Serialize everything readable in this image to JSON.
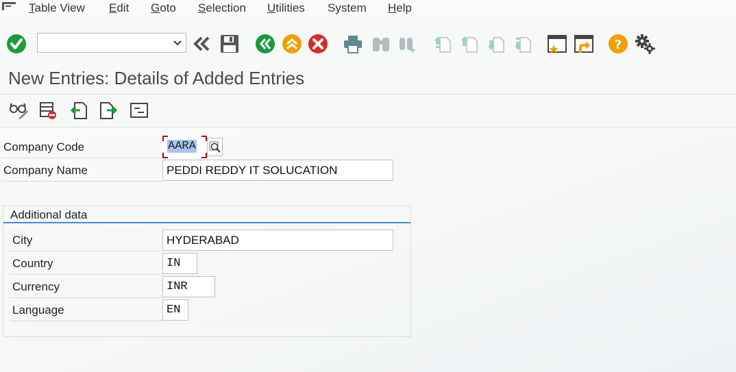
{
  "menubar": {
    "items": [
      {
        "underline": "T",
        "rest": "able View"
      },
      {
        "underline": "E",
        "rest": "dit"
      },
      {
        "underline": "G",
        "rest": "oto"
      },
      {
        "underline": "S",
        "rest": "election"
      },
      {
        "underline": "U",
        "rest": "tilities"
      },
      {
        "underline": "",
        "rest": "System"
      },
      {
        "underline": "H",
        "rest": "elp"
      }
    ]
  },
  "toolbar": {
    "command_value": "",
    "icons": [
      "enter-icon",
      "back-chevrons-icon",
      "save-icon",
      "back-icon",
      "exit-icon",
      "cancel-icon",
      "print-icon",
      "find-icon",
      "find-next-icon",
      "first-page-icon",
      "previous-page-icon",
      "next-page-icon",
      "last-page-icon",
      "new-session-icon",
      "generate-shortcut-icon",
      "help-icon",
      "settings-gear-icon"
    ],
    "colors": {
      "green": "#1a9b3c",
      "orange": "#f0a000",
      "red": "#d92b2b",
      "teal": "#5f8a8f",
      "gray": "#b5bcc0"
    }
  },
  "page": {
    "title": "New Entries: Details of Added Entries"
  },
  "app_toolbar": {
    "icons": [
      "display-change-icon",
      "delete-icon",
      "previous-entry-icon",
      "next-entry-icon",
      "select-block-icon"
    ]
  },
  "form": {
    "company_code_label": "Company Code",
    "company_code_value": "AARA",
    "company_name_label": "Company Name",
    "company_name_value": "PEDDI REDDY IT SOLUCATION"
  },
  "additional_data": {
    "title": "Additional data",
    "city_label": "City",
    "city_value": "HYDERABAD",
    "country_label": "Country",
    "country_value": "IN",
    "currency_label": "Currency",
    "currency_value": "INR",
    "language_label": "Language",
    "language_value": "EN"
  }
}
